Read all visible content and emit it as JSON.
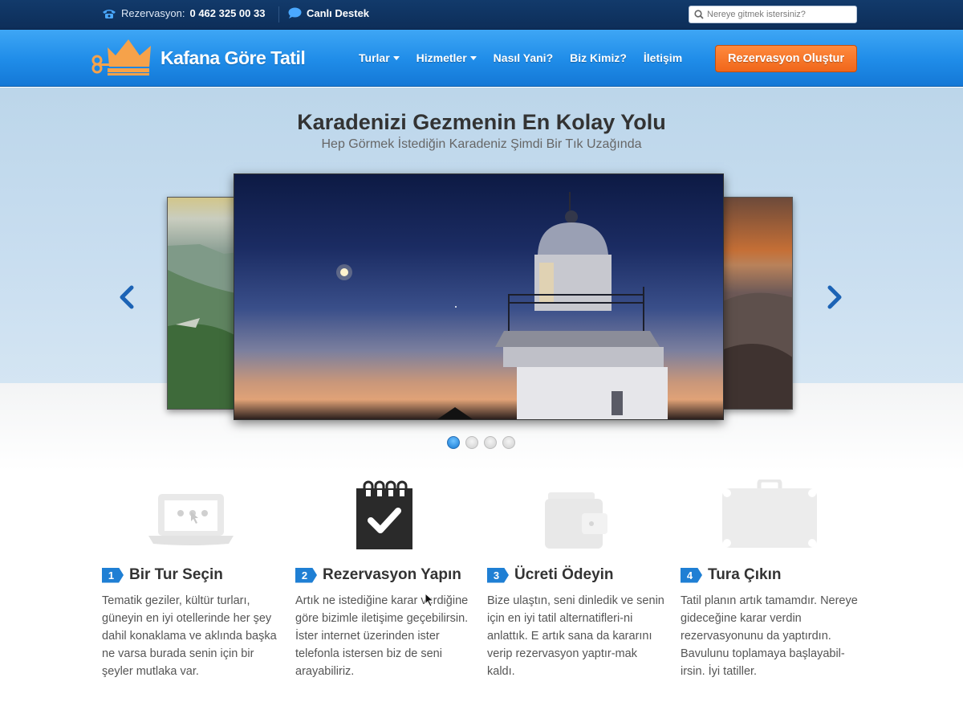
{
  "topbar": {
    "phone_label": "Rezervasyon:",
    "phone_number": "0 462 325 00 33",
    "chat_label": "Canlı Destek",
    "search_placeholder": "Nereye gitmek istersiniz?"
  },
  "nav": {
    "brand": "Kafana Göre Tatil",
    "items": [
      {
        "label": "Turlar",
        "dropdown": true
      },
      {
        "label": "Hizmetler",
        "dropdown": true
      },
      {
        "label": "Nasıl Yani?",
        "dropdown": false
      },
      {
        "label": "Biz Kimiz?",
        "dropdown": false
      },
      {
        "label": "İletişim",
        "dropdown": false
      }
    ],
    "cta_label": "Rezervasyon Oluştur"
  },
  "hero": {
    "title": "Karadenizi Gezmenin En Kolay Yolu",
    "subtitle": "Hep Görmek İstediğin Karadeniz Şimdi Bir Tık Uzağında",
    "slide_count": 4,
    "active_slide": 1
  },
  "steps": [
    {
      "number": "1",
      "title": "Bir Tur Seçin",
      "icon": "laptop-icon",
      "desc": "Tematik geziler, kültür turları, güneyin en iyi otellerinde her şey dahil konaklama ve aklında başka ne varsa burada senin için bir şeyler mutlaka var."
    },
    {
      "number": "2",
      "title": "Rezervasyon Yapın",
      "icon": "notepad-check-icon",
      "desc": "Artık ne istediğine karar verdiğine göre bizimle iletişime geçebilirsin. İster internet üzerinden ister telefonla istersen biz de seni arayabiliriz."
    },
    {
      "number": "3",
      "title": "Ücreti Ödeyin",
      "icon": "wallet-icon",
      "desc": "Bize ulaştın, seni dinledik ve senin için en iyi tatil alternatifleri-ni anlattık. E artık sana da kararını verip rezervasyon yaptır-mak kaldı."
    },
    {
      "number": "4",
      "title": "Tura Çıkın",
      "icon": "suitcase-icon",
      "desc": "Tatil planın artık tamamdır. Nereye gideceğine karar verdin rezervasyonunu da yaptırdın. Bavulunu toplamaya başlayabil-irsin. İyi tatiller."
    }
  ]
}
